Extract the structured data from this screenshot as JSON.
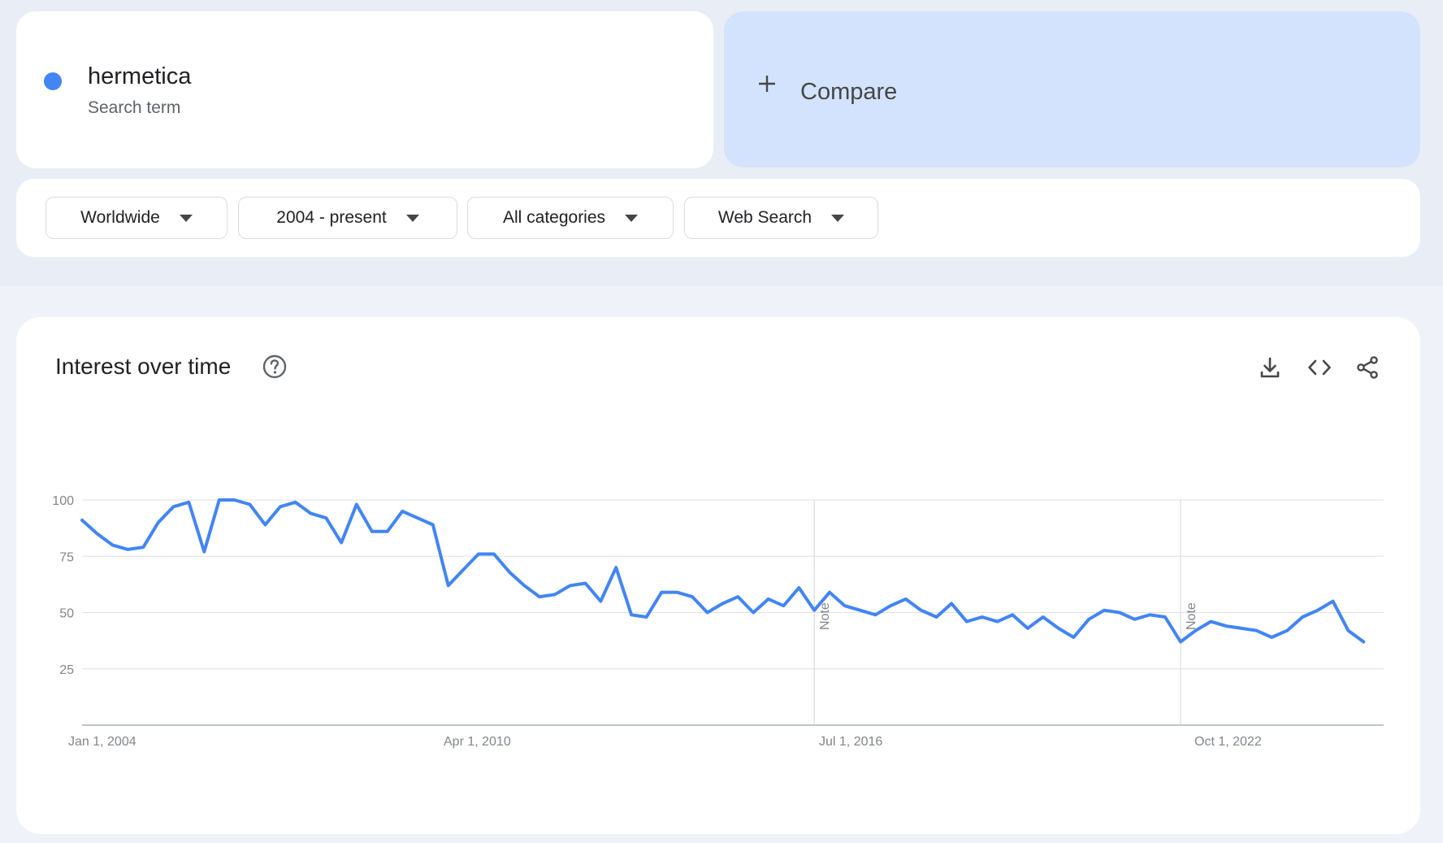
{
  "search_term": {
    "name": "hermetica",
    "type_label": "Search term",
    "color": "#4285f4"
  },
  "compare": {
    "label": "Compare"
  },
  "filters": [
    {
      "label": "Worldwide"
    },
    {
      "label": "2004 - present"
    },
    {
      "label": "All categories"
    },
    {
      "label": "Web Search"
    }
  ],
  "chart_panel": {
    "title": "Interest over time",
    "icons": [
      "help-icon",
      "download-icon",
      "embed-icon",
      "share-icon"
    ]
  },
  "chart_data": {
    "type": "line",
    "x_range": [
      "2004-01-01",
      "2025-05-01"
    ],
    "ylim": [
      0,
      100
    ],
    "y_ticks": [
      25,
      50,
      75,
      100
    ],
    "x_ticks": [
      "Jan 1, 2004",
      "Apr 1, 2010",
      "Jul 1, 2016",
      "Oct 1, 2022"
    ],
    "grid": true,
    "notes": [
      {
        "date": "2016-01-01",
        "label": "Note"
      },
      {
        "date": "2022-01-01",
        "label": "Note"
      }
    ],
    "series": [
      {
        "color": "#4285f4",
        "points": [
          [
            "2004-01-01",
            91
          ],
          [
            "2004-04-01",
            85
          ],
          [
            "2004-07-01",
            80
          ],
          [
            "2004-10-01",
            78
          ],
          [
            "2005-01-01",
            79
          ],
          [
            "2005-04-01",
            90
          ],
          [
            "2005-07-01",
            97
          ],
          [
            "2005-10-01",
            99
          ],
          [
            "2006-01-01",
            77
          ],
          [
            "2006-04-01",
            100
          ],
          [
            "2006-07-01",
            100
          ],
          [
            "2006-10-01",
            98
          ],
          [
            "2007-01-01",
            89
          ],
          [
            "2007-04-01",
            97
          ],
          [
            "2007-07-01",
            99
          ],
          [
            "2007-10-01",
            94
          ],
          [
            "2008-01-01",
            92
          ],
          [
            "2008-04-01",
            81
          ],
          [
            "2008-07-01",
            98
          ],
          [
            "2008-10-01",
            86
          ],
          [
            "2009-01-01",
            86
          ],
          [
            "2009-04-01",
            95
          ],
          [
            "2009-07-01",
            92
          ],
          [
            "2009-10-01",
            89
          ],
          [
            "2010-01-01",
            62
          ],
          [
            "2010-04-01",
            69
          ],
          [
            "2010-07-01",
            76
          ],
          [
            "2010-10-01",
            76
          ],
          [
            "2011-01-01",
            68
          ],
          [
            "2011-04-01",
            62
          ],
          [
            "2011-07-01",
            57
          ],
          [
            "2011-10-01",
            58
          ],
          [
            "2012-01-01",
            62
          ],
          [
            "2012-04-01",
            63
          ],
          [
            "2012-07-01",
            55
          ],
          [
            "2012-10-01",
            70
          ],
          [
            "2013-01-01",
            49
          ],
          [
            "2013-04-01",
            48
          ],
          [
            "2013-07-01",
            59
          ],
          [
            "2013-10-01",
            59
          ],
          [
            "2014-01-01",
            57
          ],
          [
            "2014-04-01",
            50
          ],
          [
            "2014-07-01",
            54
          ],
          [
            "2014-10-01",
            57
          ],
          [
            "2015-01-01",
            50
          ],
          [
            "2015-04-01",
            56
          ],
          [
            "2015-07-01",
            53
          ],
          [
            "2015-10-01",
            61
          ],
          [
            "2016-01-01",
            51
          ],
          [
            "2016-04-01",
            59
          ],
          [
            "2016-07-01",
            53
          ],
          [
            "2016-10-01",
            51
          ],
          [
            "2017-01-01",
            49
          ],
          [
            "2017-04-01",
            53
          ],
          [
            "2017-07-01",
            56
          ],
          [
            "2017-10-01",
            51
          ],
          [
            "2018-01-01",
            48
          ],
          [
            "2018-04-01",
            54
          ],
          [
            "2018-07-01",
            46
          ],
          [
            "2018-10-01",
            48
          ],
          [
            "2019-01-01",
            46
          ],
          [
            "2019-04-01",
            49
          ],
          [
            "2019-07-01",
            43
          ],
          [
            "2019-10-01",
            48
          ],
          [
            "2020-01-01",
            43
          ],
          [
            "2020-04-01",
            39
          ],
          [
            "2020-07-01",
            47
          ],
          [
            "2020-10-01",
            51
          ],
          [
            "2021-01-01",
            50
          ],
          [
            "2021-04-01",
            47
          ],
          [
            "2021-07-01",
            49
          ],
          [
            "2021-10-01",
            48
          ],
          [
            "2022-01-01",
            37
          ],
          [
            "2022-04-01",
            42
          ],
          [
            "2022-07-01",
            46
          ],
          [
            "2022-10-01",
            44
          ],
          [
            "2023-01-01",
            43
          ],
          [
            "2023-04-01",
            42
          ],
          [
            "2023-07-01",
            39
          ],
          [
            "2023-10-01",
            42
          ],
          [
            "2024-01-01",
            48
          ],
          [
            "2024-04-01",
            51
          ],
          [
            "2024-07-01",
            55
          ],
          [
            "2024-10-01",
            42
          ],
          [
            "2025-01-01",
            37
          ]
        ]
      }
    ]
  }
}
